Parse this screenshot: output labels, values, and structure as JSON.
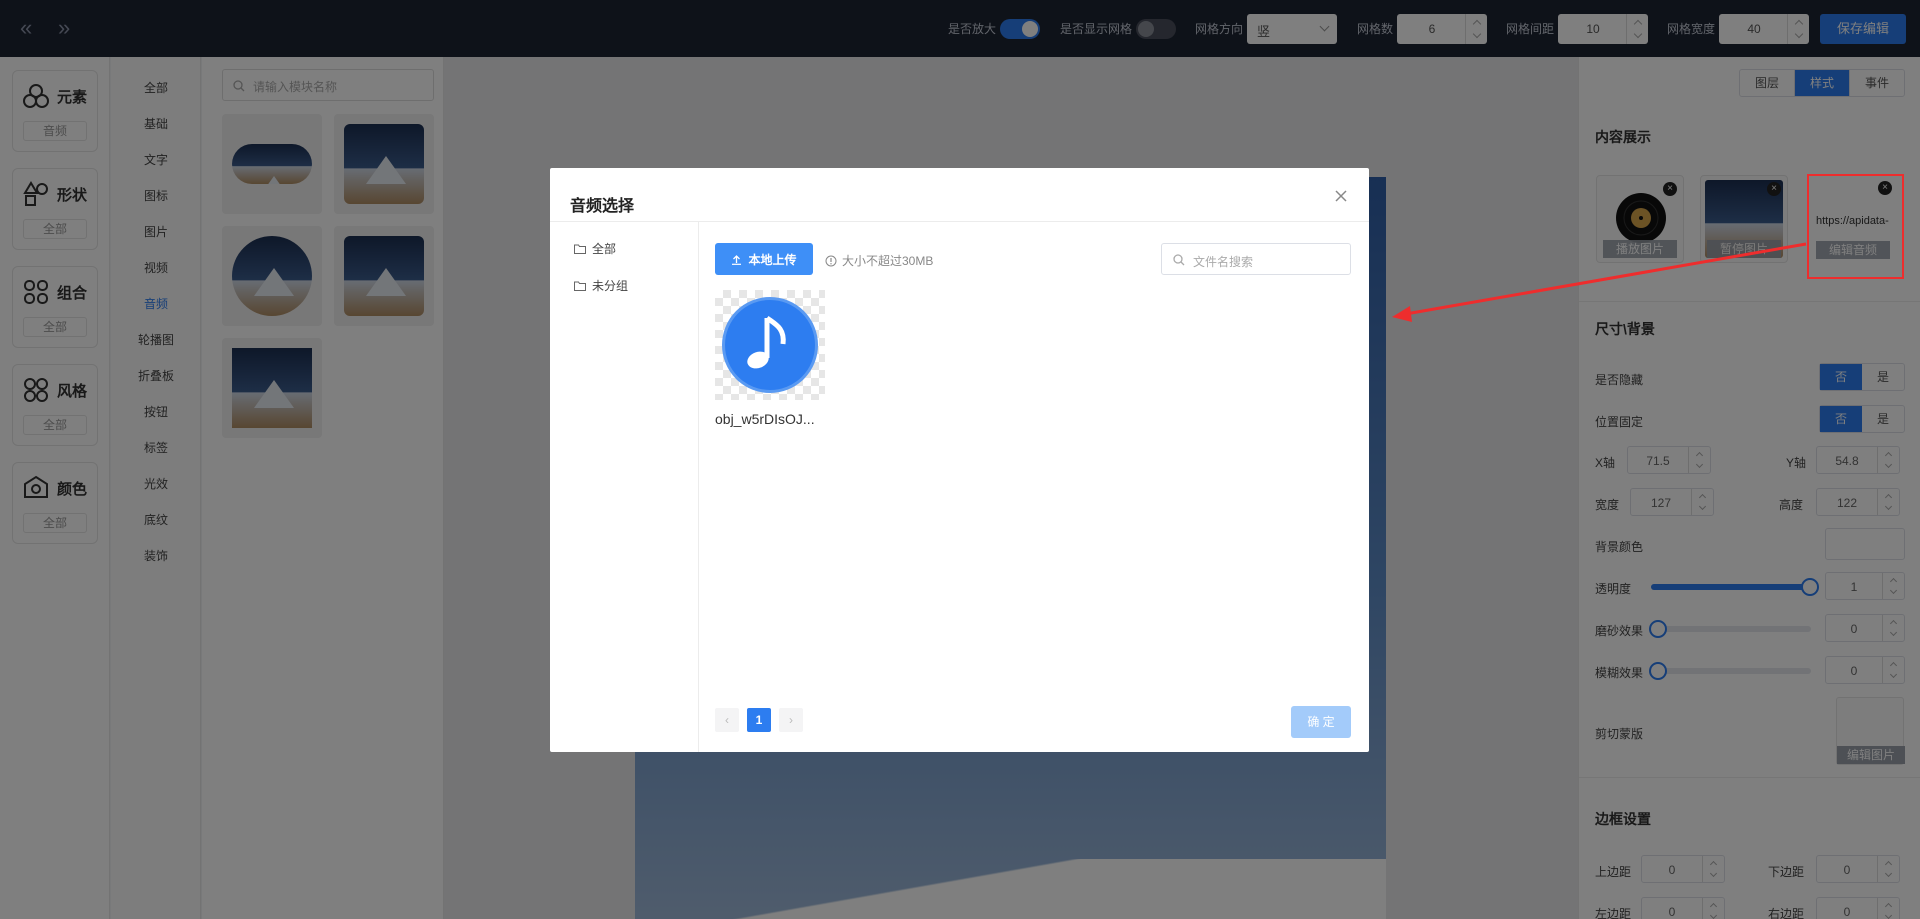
{
  "topbar": {
    "zoom_label": "是否放大",
    "grid_show_label": "是否显示网格",
    "grid_dir_label": "网格方向",
    "grid_dir_value": "竖",
    "grid_count_label": "网格数",
    "grid_count_value": "6",
    "grid_gap_label": "网格间距",
    "grid_gap_value": "10",
    "grid_width_label": "网格宽度",
    "grid_width_value": "40",
    "save_label": "保存编辑"
  },
  "categories": [
    {
      "name": "元素",
      "sub": "音频"
    },
    {
      "name": "形状",
      "sub": "全部"
    },
    {
      "name": "组合",
      "sub": "全部"
    },
    {
      "name": "风格",
      "sub": "全部"
    },
    {
      "name": "颜色",
      "sub": "全部"
    }
  ],
  "subcategories": [
    "全部",
    "基础",
    "文字",
    "图标",
    "图片",
    "视频",
    "音频",
    "轮播图",
    "折叠板",
    "按钮",
    "标签",
    "光效",
    "底纹",
    "装饰"
  ],
  "module_search_placeholder": "请输入模块名称",
  "right_panel": {
    "tabs": [
      "图层",
      "样式",
      "事件"
    ],
    "content_title": "内容展示",
    "media": [
      {
        "caption": "播放图片"
      },
      {
        "caption": "暂停图片"
      },
      {
        "text": "https://apidata-",
        "caption": "编辑音频"
      }
    ],
    "size_title": "尺寸\\背景",
    "hidden_label": "是否隐藏",
    "fixed_label": "位置固定",
    "no": "否",
    "yes": "是",
    "x_label": "X轴",
    "x_value": "71.5",
    "y_label": "Y轴",
    "y_value": "54.8",
    "w_label": "宽度",
    "w_value": "127",
    "h_label": "高度",
    "h_value": "122",
    "bg_label": "背景颜色",
    "opacity_label": "透明度",
    "opacity_value": "1",
    "frost_label": "磨砂效果",
    "frost_value": "0",
    "blur_label": "模糊效果",
    "blur_value": "0",
    "mask_label": "剪切蒙版",
    "mask_caption": "编辑图片",
    "border_title": "边框设置",
    "top_label": "上边距",
    "top_value": "0",
    "bottom_label": "下边距",
    "bottom_value": "0",
    "left_label": "左边距",
    "left_value": "0",
    "right_label": "右边距",
    "right_value": "0"
  },
  "dialog": {
    "title": "音频选择",
    "folders": [
      "全部",
      "未分组"
    ],
    "upload_label": "本地上传",
    "size_hint": "大小不超过30MB",
    "search_placeholder": "文件名搜索",
    "file_name": "obj_w5rDIsOJ...",
    "page": "1",
    "confirm_label": "确 定"
  },
  "colors": {
    "accent": "#2d7df0",
    "annotation": "#ee2d2d",
    "topbar": "#1d2433"
  }
}
